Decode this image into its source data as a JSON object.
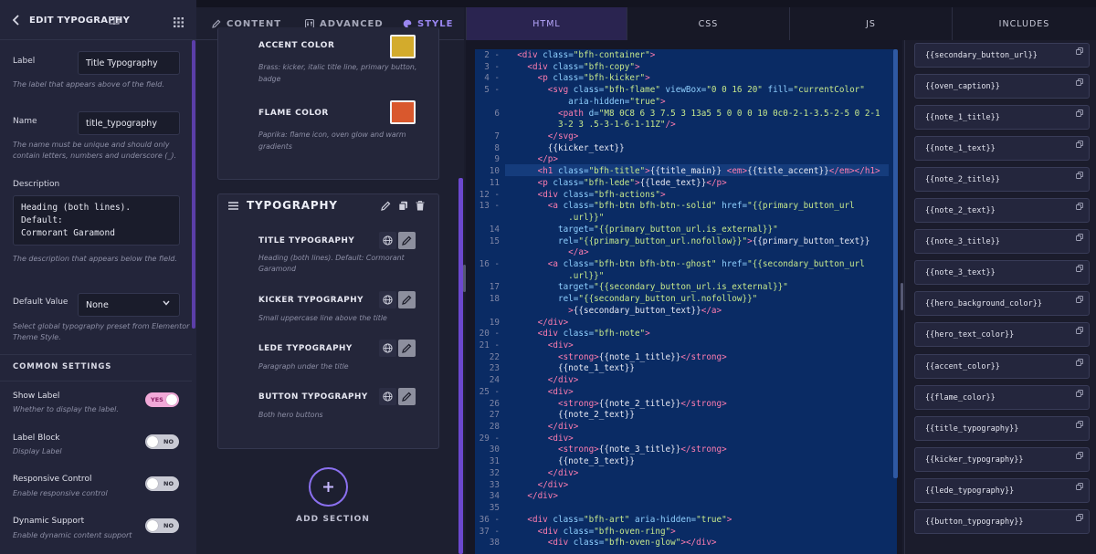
{
  "left_panel": {
    "title": "EDIT TYPOGRAPHY",
    "fields": {
      "label": {
        "label": "Label",
        "value": "Title Typography",
        "help": "The label that appears above of the field."
      },
      "name": {
        "label": "Name",
        "value": "title_typography",
        "help_1": "The name must be unique and should only",
        "help_2": "contain letters, numbers and underscore (_)."
      },
      "description": {
        "label": "Description",
        "value": "Heading (both lines). Default:\nCormorant Garamond",
        "help": "The description that appears below the field."
      },
      "default_value": {
        "label": "Default Value",
        "value": "None",
        "help_1": "Select global typography preset from Elementor",
        "help_2": "Theme Style."
      }
    },
    "common_settings": "COMMON SETTINGS",
    "switches": [
      {
        "label": "Show Label",
        "help": "Whether to display the label.",
        "state": "YES"
      },
      {
        "label": "Label Block",
        "help": "Display Label",
        "state": "NO"
      },
      {
        "label": "Responsive Control",
        "help": "Enable responsive control",
        "state": "NO"
      },
      {
        "label": "Dynamic Support",
        "help": "Enable dynamic content support",
        "state": "NO"
      }
    ]
  },
  "middle_panel": {
    "tabs": [
      {
        "label": "CONTENT",
        "icon": "pencil-icon"
      },
      {
        "label": "ADVANCED",
        "icon": "sliders-icon"
      },
      {
        "label": "STYLE",
        "icon": "palette-icon"
      }
    ],
    "colors": [
      {
        "label": "ACCENT COLOR",
        "help_1": "Brass: kicker, italic title line, primary button,",
        "help_2": "badge",
        "color": "#d3ab2c"
      },
      {
        "label": "FLAME COLOR",
        "help_1": "Paprika: flame icon, oven glow and warm",
        "help_2": "gradients",
        "color": "#d9582d"
      }
    ],
    "section_title": "TYPOGRAPHY",
    "typography_controls": [
      {
        "label": "TITLE TYPOGRAPHY",
        "help_1": "Heading (both lines). Default: Cormorant",
        "help_2": "Garamond"
      },
      {
        "label": "KICKER TYPOGRAPHY",
        "help_1": "Small uppercase line above the title",
        "help_2": ""
      },
      {
        "label": "LEDE TYPOGRAPHY",
        "help_1": "Paragraph under the title",
        "help_2": ""
      },
      {
        "label": "BUTTON TYPOGRAPHY",
        "help_1": "Both hero buttons",
        "help_2": ""
      }
    ],
    "add_section": "ADD SECTION"
  },
  "code_editor": {
    "tabs": [
      "HTML",
      "CSS",
      "JS",
      "INCLUDES"
    ],
    "active_tab": "HTML"
  },
  "includes": [
    "{{secondary_button_url}}",
    "{{oven_caption}}",
    "{{note_1_title}}",
    "{{note_1_text}}",
    "{{note_2_title}}",
    "{{note_2_text}}",
    "{{note_3_title}}",
    "{{note_3_text}}",
    "{{hero_background_color}}",
    "{{hero_text_color}}",
    "{{accent_color}}",
    "{{flame_color}}",
    "{{title_typography}}",
    "{{kicker_typography}}",
    "{{lede_typography}}",
    "{{button_typography}}"
  ],
  "code_lines": [
    {
      "n": "2",
      "fold": true,
      "segs": [
        [
          "  ",
          "tx"
        ],
        [
          "<div ",
          "tg"
        ],
        [
          "class=",
          "at"
        ],
        [
          "\"bfh-container\"",
          "st"
        ],
        [
          ">",
          "tg"
        ]
      ]
    },
    {
      "n": "3",
      "fold": true,
      "segs": [
        [
          "    ",
          "tx"
        ],
        [
          "<div ",
          "tg"
        ],
        [
          "class=",
          "at"
        ],
        [
          "\"bfh-copy\"",
          "st"
        ],
        [
          ">",
          "tg"
        ]
      ]
    },
    {
      "n": "4",
      "fold": true,
      "segs": [
        [
          "      ",
          "tx"
        ],
        [
          "<p ",
          "tg"
        ],
        [
          "class=",
          "at"
        ],
        [
          "\"bfh-kicker\"",
          "st"
        ],
        [
          ">",
          "tg"
        ]
      ]
    },
    {
      "n": "5",
      "fold": true,
      "segs": [
        [
          "        ",
          "tx"
        ],
        [
          "<svg ",
          "tg"
        ],
        [
          "class=",
          "at"
        ],
        [
          "\"bfh-flame\" ",
          "st"
        ],
        [
          "viewBox=",
          "at"
        ],
        [
          "\"0 0 16 20\" ",
          "st"
        ],
        [
          "fill=",
          "at"
        ],
        [
          "\"currentColor\"",
          "st"
        ]
      ]
    },
    {
      "n": "",
      "fold": false,
      "segs": [
        [
          "            ",
          "tx"
        ],
        [
          "aria-hidden=",
          "at"
        ],
        [
          "\"true\"",
          "st"
        ],
        [
          ">",
          "tg"
        ]
      ]
    },
    {
      "n": "6",
      "fold": false,
      "segs": [
        [
          "          ",
          "tx"
        ],
        [
          "<path ",
          "tg"
        ],
        [
          "d=",
          "at"
        ],
        [
          "\"M8 0C8 6 3 7.5 3 13a5 5 0 0 0 10 0c0-2-1-3.5-2-5 0 2-1",
          "st"
        ]
      ]
    },
    {
      "n": "",
      "fold": false,
      "segs": [
        [
          "          ",
          "tx"
        ],
        [
          "3-2 3 .5-3-1-6-1-11Z\"",
          "st"
        ],
        [
          "/>",
          "tg"
        ]
      ]
    },
    {
      "n": "7",
      "fold": false,
      "segs": [
        [
          "        ",
          "tx"
        ],
        [
          "</svg>",
          "tg"
        ]
      ]
    },
    {
      "n": "8",
      "fold": false,
      "segs": [
        [
          "        ",
          "tx"
        ],
        [
          "{{kicker_text}}",
          "tx"
        ]
      ]
    },
    {
      "n": "9",
      "fold": false,
      "segs": [
        [
          "      ",
          "tx"
        ],
        [
          "</p>",
          "tg"
        ]
      ]
    },
    {
      "n": "10",
      "fold": false,
      "segs": [
        [
          "      ",
          "tx"
        ],
        [
          "<h1 ",
          "tg"
        ],
        [
          "class=",
          "at"
        ],
        [
          "\"bfh-title\"",
          "st"
        ],
        [
          ">",
          "tg"
        ],
        [
          "{{title_main}} ",
          "tx"
        ],
        [
          "<em>",
          "tg"
        ],
        [
          "{{title_accent}}",
          "tx"
        ],
        [
          "</em></h1>",
          "tg"
        ]
      ]
    },
    {
      "n": "11",
      "fold": false,
      "segs": [
        [
          "      ",
          "tx"
        ],
        [
          "<p ",
          "tg"
        ],
        [
          "class=",
          "at"
        ],
        [
          "\"bfh-lede\"",
          "st"
        ],
        [
          ">",
          "tg"
        ],
        [
          "{{lede_text}}",
          "tx"
        ],
        [
          "</p>",
          "tg"
        ]
      ]
    },
    {
      "n": "12",
      "fold": true,
      "segs": [
        [
          "      ",
          "tx"
        ],
        [
          "<div ",
          "tg"
        ],
        [
          "class=",
          "at"
        ],
        [
          "\"bfh-actions\"",
          "st"
        ],
        [
          ">",
          "tg"
        ]
      ]
    },
    {
      "n": "13",
      "fold": true,
      "segs": [
        [
          "        ",
          "tx"
        ],
        [
          "<a ",
          "tg"
        ],
        [
          "class=",
          "at"
        ],
        [
          "\"bfh-btn bfh-btn--solid\" ",
          "st"
        ],
        [
          "href=",
          "at"
        ],
        [
          "\"{{primary_button_url",
          "st"
        ]
      ]
    },
    {
      "n": "",
      "fold": false,
      "segs": [
        [
          "            ",
          "tx"
        ],
        [
          ".url}}\"",
          "st"
        ]
      ]
    },
    {
      "n": "14",
      "fold": false,
      "segs": [
        [
          "          ",
          "tx"
        ],
        [
          "target=",
          "at"
        ],
        [
          "\"{{primary_button_url.is_external}}\"",
          "st"
        ]
      ]
    },
    {
      "n": "15",
      "fold": false,
      "segs": [
        [
          "          ",
          "tx"
        ],
        [
          "rel=",
          "at"
        ],
        [
          "\"{{primary_button_url.nofollow}}\"",
          "st"
        ],
        [
          ">",
          "tg"
        ],
        [
          "{{primary_button_text}}",
          "tx"
        ]
      ]
    },
    {
      "n": "",
      "fold": false,
      "segs": [
        [
          "            ",
          "tx"
        ],
        [
          "</a>",
          "tg"
        ]
      ]
    },
    {
      "n": "16",
      "fold": true,
      "segs": [
        [
          "        ",
          "tx"
        ],
        [
          "<a ",
          "tg"
        ],
        [
          "class=",
          "at"
        ],
        [
          "\"bfh-btn bfh-btn--ghost\" ",
          "st"
        ],
        [
          "href=",
          "at"
        ],
        [
          "\"{{secondary_button_url",
          "st"
        ]
      ]
    },
    {
      "n": "",
      "fold": false,
      "segs": [
        [
          "            ",
          "tx"
        ],
        [
          ".url}}\"",
          "st"
        ]
      ]
    },
    {
      "n": "17",
      "fold": false,
      "segs": [
        [
          "          ",
          "tx"
        ],
        [
          "target=",
          "at"
        ],
        [
          "\"{{secondary_button_url.is_external}}\"",
          "st"
        ]
      ]
    },
    {
      "n": "18",
      "fold": false,
      "segs": [
        [
          "          ",
          "tx"
        ],
        [
          "rel=",
          "at"
        ],
        [
          "\"{{secondary_button_url.nofollow}}\"",
          "st"
        ]
      ]
    },
    {
      "n": "",
      "fold": false,
      "segs": [
        [
          "            ",
          "tx"
        ],
        [
          ">",
          "tg"
        ],
        [
          "{{secondary_button_text}}",
          "tx"
        ],
        [
          "</a>",
          "tg"
        ]
      ]
    },
    {
      "n": "19",
      "fold": false,
      "segs": [
        [
          "      ",
          "tx"
        ],
        [
          "</div>",
          "tg"
        ]
      ]
    },
    {
      "n": "20",
      "fold": true,
      "segs": [
        [
          "      ",
          "tx"
        ],
        [
          "<div ",
          "tg"
        ],
        [
          "class=",
          "at"
        ],
        [
          "\"bfh-note\"",
          "st"
        ],
        [
          ">",
          "tg"
        ]
      ]
    },
    {
      "n": "21",
      "fold": true,
      "segs": [
        [
          "        ",
          "tx"
        ],
        [
          "<div>",
          "tg"
        ]
      ]
    },
    {
      "n": "22",
      "fold": false,
      "segs": [
        [
          "          ",
          "tx"
        ],
        [
          "<strong>",
          "tg"
        ],
        [
          "{{note_1_title}}",
          "tx"
        ],
        [
          "</strong>",
          "tg"
        ]
      ]
    },
    {
      "n": "23",
      "fold": false,
      "segs": [
        [
          "          ",
          "tx"
        ],
        [
          "{{note_1_text}}",
          "tx"
        ]
      ]
    },
    {
      "n": "24",
      "fold": false,
      "segs": [
        [
          "        ",
          "tx"
        ],
        [
          "</div>",
          "tg"
        ]
      ]
    },
    {
      "n": "25",
      "fold": true,
      "segs": [
        [
          "        ",
          "tx"
        ],
        [
          "<div>",
          "tg"
        ]
      ]
    },
    {
      "n": "26",
      "fold": false,
      "segs": [
        [
          "          ",
          "tx"
        ],
        [
          "<strong>",
          "tg"
        ],
        [
          "{{note_2_title}}",
          "tx"
        ],
        [
          "</strong>",
          "tg"
        ]
      ]
    },
    {
      "n": "27",
      "fold": false,
      "segs": [
        [
          "          ",
          "tx"
        ],
        [
          "{{note_2_text}}",
          "tx"
        ]
      ]
    },
    {
      "n": "28",
      "fold": false,
      "segs": [
        [
          "        ",
          "tx"
        ],
        [
          "</div>",
          "tg"
        ]
      ]
    },
    {
      "n": "29",
      "fold": true,
      "segs": [
        [
          "        ",
          "tx"
        ],
        [
          "<div>",
          "tg"
        ]
      ]
    },
    {
      "n": "30",
      "fold": false,
      "segs": [
        [
          "          ",
          "tx"
        ],
        [
          "<strong>",
          "tg"
        ],
        [
          "{{note_3_title}}",
          "tx"
        ],
        [
          "</strong>",
          "tg"
        ]
      ]
    },
    {
      "n": "31",
      "fold": false,
      "segs": [
        [
          "          ",
          "tx"
        ],
        [
          "{{note_3_text}}",
          "tx"
        ]
      ]
    },
    {
      "n": "32",
      "fold": false,
      "segs": [
        [
          "        ",
          "tx"
        ],
        [
          "</div>",
          "tg"
        ]
      ]
    },
    {
      "n": "33",
      "fold": false,
      "segs": [
        [
          "      ",
          "tx"
        ],
        [
          "</div>",
          "tg"
        ]
      ]
    },
    {
      "n": "34",
      "fold": false,
      "segs": [
        [
          "    ",
          "tx"
        ],
        [
          "</div>",
          "tg"
        ]
      ]
    },
    {
      "n": "35",
      "fold": false,
      "segs": []
    },
    {
      "n": "36",
      "fold": true,
      "segs": [
        [
          "    ",
          "tx"
        ],
        [
          "<div ",
          "tg"
        ],
        [
          "class=",
          "at"
        ],
        [
          "\"bfh-art\" ",
          "st"
        ],
        [
          "aria-hidden=",
          "at"
        ],
        [
          "\"true\"",
          "st"
        ],
        [
          ">",
          "tg"
        ]
      ]
    },
    {
      "n": "37",
      "fold": true,
      "segs": [
        [
          "      ",
          "tx"
        ],
        [
          "<div ",
          "tg"
        ],
        [
          "class=",
          "at"
        ],
        [
          "\"bfh-oven-ring\"",
          "st"
        ],
        [
          ">",
          "tg"
        ]
      ]
    },
    {
      "n": "38",
      "fold": false,
      "segs": [
        [
          "        ",
          "tx"
        ],
        [
          "<div ",
          "tg"
        ],
        [
          "class=",
          "at"
        ],
        [
          "\"bfh-oven-glow\"",
          "st"
        ],
        [
          "></div>",
          "tg"
        ]
      ]
    }
  ]
}
